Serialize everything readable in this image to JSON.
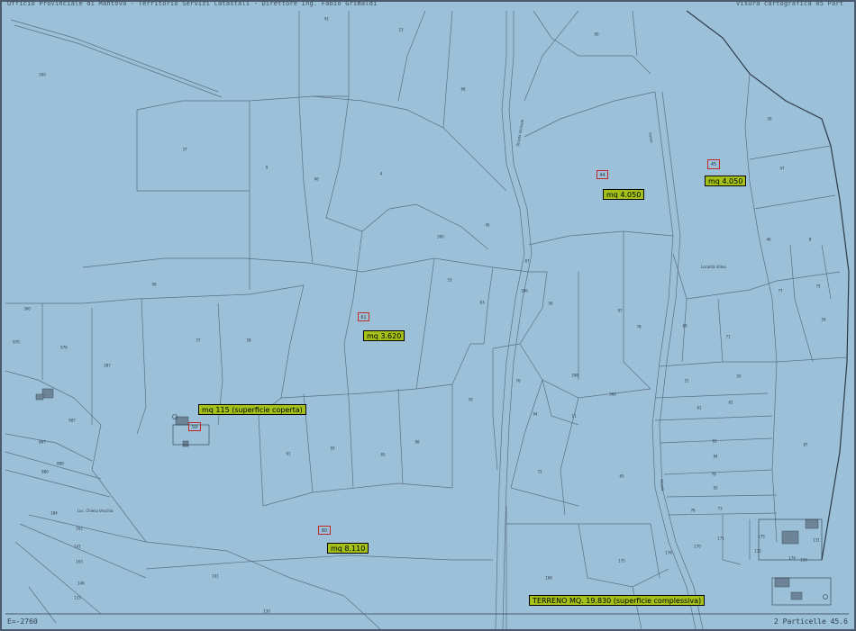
{
  "header": {
    "left": "Ufficio Provinciale di Mantova - Territorio Servizi Catastali - Direttore Ing. Fabio Grimaldi",
    "right": "Visura cartografica 05 Part"
  },
  "footer": {
    "left": "E=-2760",
    "right": "2 Particelle   45.6"
  },
  "highlighted_parcels": {
    "p1": "44",
    "p2": "45",
    "p3": "61",
    "p4": "80",
    "p5": "59"
  },
  "area_labels": {
    "a1": "mq 4.050",
    "a2": "mq 4.050",
    "a3": "mq 3.620",
    "a4": "mq 115 (superficie coperta)",
    "a5": "mq 8.110",
    "a6": "TERRENO MQ. 19.830 (superficie complessiva)"
  },
  "place_names": {
    "n1": "Località Villoa",
    "n2": "Loc. Chiesa Vecchia"
  },
  "road_names": {
    "r1": "Strada Vicinale",
    "r2": "Fosso",
    "r3": "Strada"
  },
  "parcel_numbers": [
    "43",
    "23",
    "90",
    "300",
    "66",
    "37",
    "9",
    "40",
    "4",
    "26",
    "46",
    "47",
    "8",
    "99",
    "300",
    "45",
    "87",
    "53",
    "386",
    "63",
    "56",
    "77",
    "75",
    "97",
    "78",
    "59",
    "57",
    "58",
    "387",
    "11",
    "50",
    "51",
    "69",
    "398",
    "94",
    "360",
    "93",
    "88",
    "70",
    "76",
    "71",
    "72",
    "91",
    "83",
    "84",
    "61",
    "62",
    "87",
    "92",
    "65",
    "65",
    "79",
    "76",
    "73",
    "170",
    "171",
    "176",
    "175",
    "184",
    "168",
    "101",
    "130",
    "146",
    "141",
    "133",
    "162",
    "163",
    "131",
    "132",
    "175",
    "174",
    "150",
    "360",
    "970",
    "976",
    "987",
    "867",
    "888",
    "880"
  ],
  "colors": {
    "map_fill": "#9cc0d8",
    "boundary": "#5a7086",
    "highlight_border": "#c22a2a",
    "label_fill": "#a4c11a"
  }
}
